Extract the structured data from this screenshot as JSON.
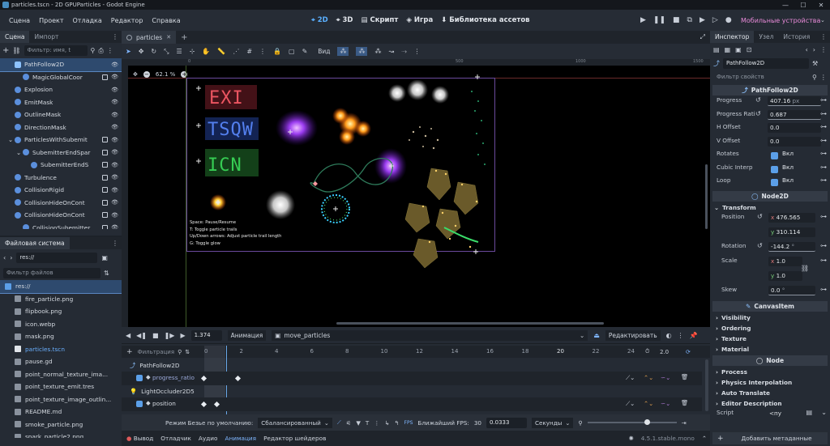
{
  "window": {
    "title": "particles.tscn - 2D GPUParticles - Godot Engine",
    "ctrl_min": "—",
    "ctrl_max": "☐",
    "ctrl_close": "✕"
  },
  "menu": [
    "Сцена",
    "Проект",
    "Отладка",
    "Редактор",
    "Справка"
  ],
  "main_screens": [
    "2D",
    "3D",
    "Скрипт",
    "Игра",
    "Библиотека ассетов"
  ],
  "renderer": "Мобильные устройства",
  "scene_dock": {
    "tabs": [
      "Сцена",
      "Импорт"
    ],
    "filter_placeholder": "Фильтр: имя, t",
    "nodes": [
      {
        "label": "PathFollow2D",
        "depth": 1,
        "selected": true
      },
      {
        "label": "MagicGlobalCoor",
        "depth": 2
      },
      {
        "label": "Explosion",
        "depth": 1
      },
      {
        "label": "EmitMask",
        "depth": 1
      },
      {
        "label": "OutlineMask",
        "depth": 1
      },
      {
        "label": "DirectionMask",
        "depth": 1
      },
      {
        "label": "ParticlesWithSubemit",
        "depth": 1,
        "expanded": true
      },
      {
        "label": "SubemitterEndSpar",
        "depth": 2,
        "expanded": true
      },
      {
        "label": "SubemitterEndS",
        "depth": 3
      },
      {
        "label": "Turbulence",
        "depth": 1
      },
      {
        "label": "CollisionRigid",
        "depth": 1
      },
      {
        "label": "CollisionHideOnCont",
        "depth": 1
      },
      {
        "label": "CollisionHideOnCont",
        "depth": 1
      },
      {
        "label": "CollisionSubemitter",
        "depth": 2
      }
    ]
  },
  "fs_dock": {
    "title": "Файловая система",
    "path": "res://",
    "filter_placeholder": "Фильтр файлов",
    "files": [
      {
        "name": "res://",
        "folder": true
      },
      {
        "name": "fire_particle.png"
      },
      {
        "name": "flipbook.png"
      },
      {
        "name": "icon.webp"
      },
      {
        "name": "mask.png"
      },
      {
        "name": "particles.tscn",
        "active": true
      },
      {
        "name": "pause.gd"
      },
      {
        "name": "point_normal_texture_ima..."
      },
      {
        "name": "point_texture_emit.tres"
      },
      {
        "name": "point_texture_image_outlin..."
      },
      {
        "name": "README.md"
      },
      {
        "name": "smoke_particle.png"
      },
      {
        "name": "spark_particle2.png"
      }
    ]
  },
  "scene_tab": {
    "label": "particles",
    "close": "✕",
    "add": "+"
  },
  "toolbar": {
    "view_label": "Вид"
  },
  "viewport": {
    "zoom": "62.1 %",
    "zoom_out": "−",
    "zoom_in": "+",
    "help": [
      "Space: Pause/Resume",
      "T: Toggle particle trails",
      "Up/Down arrows: Adjust particle trail length",
      "G: Toggle glow"
    ],
    "ruler_marks": [
      "0",
      "500",
      "1000",
      "1500"
    ]
  },
  "inspector": {
    "tabs": [
      "Инспектор",
      "Узел",
      "История"
    ],
    "node": "PathFollow2D",
    "filter_placeholder": "Фильтр свойств",
    "header": "PathFollow2D",
    "props": [
      {
        "label": "Progress",
        "value": "407.16",
        "unit": "px"
      },
      {
        "label": "Progress Rati",
        "value": "0.687"
      },
      {
        "label": "H Offset",
        "value": "0.0"
      },
      {
        "label": "V Offset",
        "value": "0.0"
      },
      {
        "label": "Rotates",
        "check": "Вкл"
      },
      {
        "label": "Cubic Interp",
        "check": "Вкл"
      },
      {
        "label": "Loop",
        "check": "Вкл"
      }
    ],
    "node2d": "Node2D",
    "transform": "Transform",
    "position_label": "Position",
    "pos_x": "476.565",
    "pos_y": "310.114",
    "x": "x",
    "y": "y",
    "rotation_label": "Rotation",
    "rotation": "-144.2",
    "deg": "°",
    "scale_label": "Scale",
    "scale_x": "1.0",
    "scale_y": "1.0",
    "skew_label": "Skew",
    "skew": "0.0",
    "canvasitem": "CanvasItem",
    "ci_sections": [
      "Visibility",
      "Ordering",
      "Texture",
      "Material"
    ],
    "node_section": "Node",
    "node_sections": [
      "Process",
      "Physics Interpolation",
      "Auto Translate",
      "Editor Description"
    ],
    "script_label": "Script",
    "script_value": "<пу",
    "add_meta": "Добавить метаданные"
  },
  "animation": {
    "time": "1.374",
    "anim_label": "Анимация",
    "anim_name": "move_particles",
    "edit": "Редактировать",
    "filter": "Фильтрация",
    "ticks": [
      "0",
      "2",
      "4",
      "6",
      "8",
      "10",
      "12",
      "14",
      "16",
      "18",
      "20",
      "22",
      "24"
    ],
    "length": "2.0",
    "tracks": [
      {
        "group": "PathFollow2D",
        "prop": "progress_ratio"
      },
      {
        "group": "LightOccluder2D5",
        "prop": "position"
      }
    ],
    "bezier_label": "Режим Безье по умолчанию:",
    "bezier_value": "Сбалансированный",
    "fps_label": "Ближайший FPS:",
    "fps": "30",
    "step": "0.0333",
    "step_unit": "Секунды"
  },
  "bottom_tabs": [
    "Вывод",
    "Отладчик",
    "Аудио",
    "Анимация",
    "Редактор шейдеров"
  ],
  "version": "4.5.1.stable.mono",
  "colors": {
    "accent": "#478cbf",
    "selection": "#3a5a85",
    "canvas": "#000000"
  }
}
